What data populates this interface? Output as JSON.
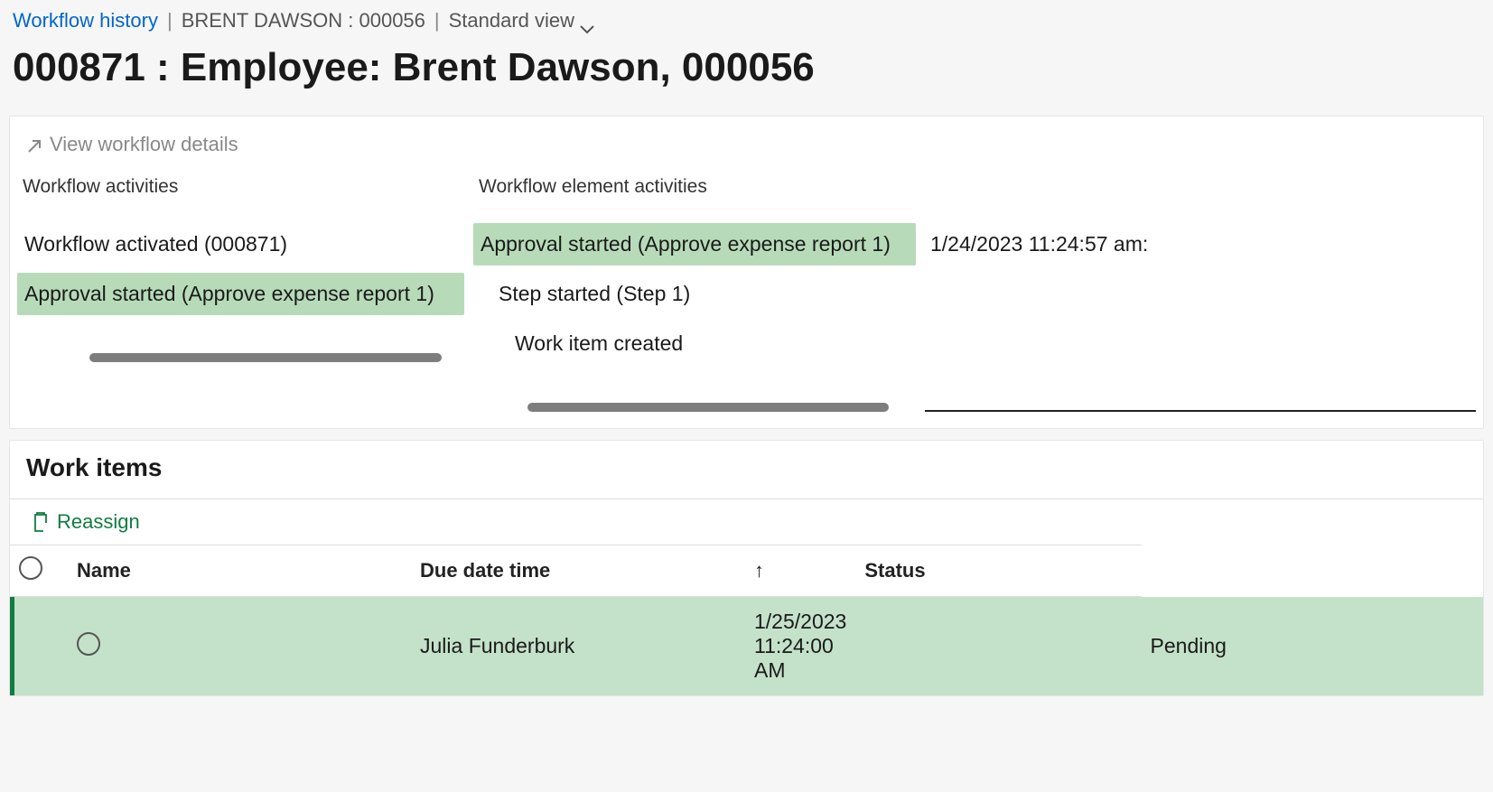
{
  "breadcrumb": {
    "link": "Workflow history",
    "record": "BRENT DAWSON : 000056",
    "view": "Standard view"
  },
  "page_title": "000871 : Employee: Brent Dawson, 000056",
  "details": {
    "view_link": "View workflow details",
    "col_a_header": "Workflow activities",
    "col_b_header": "Workflow element activities",
    "activities_a": {
      "0": "Workflow activated (000871)",
      "1": "Approval started (Approve expense report 1)"
    },
    "activities_b": {
      "0": "Approval started (Approve expense report 1)",
      "1": "Step started (Step 1)",
      "2": "Work item created"
    },
    "timestamp": "1/24/2023 11:24:57 am:"
  },
  "work_items": {
    "title": "Work items",
    "reassign_label": "Reassign",
    "columns": {
      "name": "Name",
      "due": "Due date time",
      "status": "Status"
    },
    "rows": {
      "0": {
        "name": "Julia Funderburk",
        "due": "1/25/2023 11:24:00 AM",
        "status": "Pending"
      }
    }
  }
}
